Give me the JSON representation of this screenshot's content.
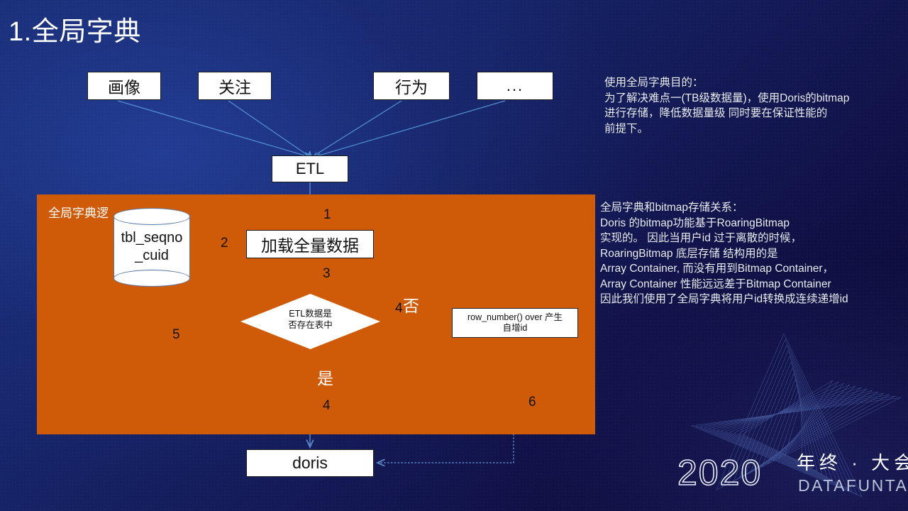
{
  "slide": {
    "title": "1.全局字典",
    "background_color": "#17276d",
    "panel_color": "#cf5a08",
    "connector_color": "#5b87c7"
  },
  "sources": [
    {
      "label": "画像"
    },
    {
      "label": "关注"
    },
    {
      "label": "行为"
    },
    {
      "label": "..."
    }
  ],
  "nodes": {
    "etl": "ETL",
    "load_full_data": "加载全量数据",
    "db_cylinder": "tbl_seqno\n_cuid",
    "db_cylinder_line1": "tbl_seqno",
    "db_cylinder_line2": "_cuid",
    "decision_line1": "ETL数据是",
    "decision_line2": "否存在表中",
    "row_number_line1": "row_number() over 产生",
    "row_number_line2": "自增id",
    "doris": "doris"
  },
  "panel": {
    "label": "全局字典逻"
  },
  "edge_labels": {
    "n1": "1",
    "n2": "2",
    "n3": "3",
    "n4_no": "4",
    "no": "否",
    "yes": "是",
    "n4_yes": "4",
    "n5": "5",
    "n6": "6"
  },
  "notes": {
    "purpose": "使用全局字典目的：\n为了解决难点一(TB级数据量)，使用Doris的bitmap\n进行存储，降低数据量级 同时要在保证性能的\n前提下。",
    "relation": "全局字典和bitmap存储关系：\nDoris 的bitmap功能基于RoaringBitmap\n实现的。 因此当用户id 过于离散的时候，\nRoaringBitmap 底层存储 结构用的是\nArray Container, 而没有用到Bitmap Container，\nArray Container 性能远远差于Bitmap Container\n因此我们使用了全局字典将用户id转换成连续递增id"
  },
  "logo": {
    "year": "2020",
    "event": "年终 · 大会",
    "brand": "DATAFUNTALK"
  }
}
